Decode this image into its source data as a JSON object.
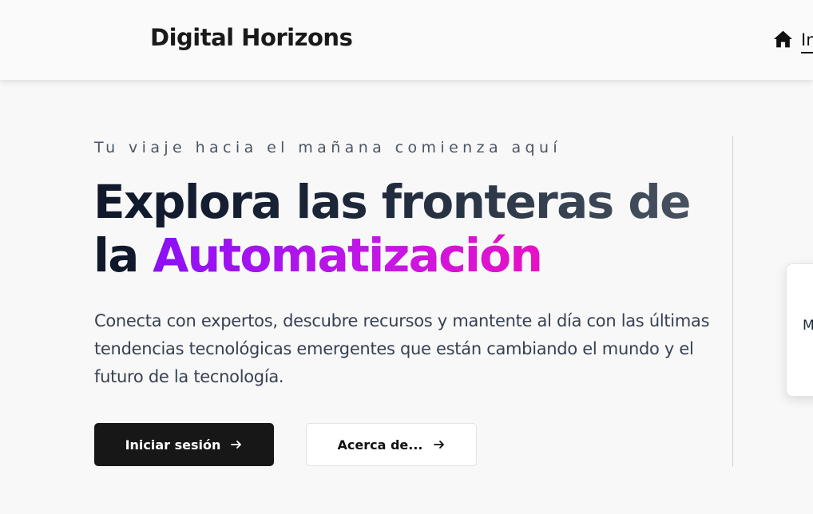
{
  "header": {
    "brand": "Digital Horizons",
    "nav": {
      "home_label": "In"
    }
  },
  "hero": {
    "eyebrow": "Tu viaje hacia el mañana comienza aquí",
    "headline_part1": "Explora las fronteras de la ",
    "headline_highlight": "Automatización",
    "description": "Conecta con expertos, descubre recursos y mantente al día con las últimas tendencias tecnológicas emergentes que están cambiando el mundo y el futuro de la tecnología.",
    "primary_button": "Iniciar sesión",
    "secondary_button": "Acerca de..."
  },
  "side_card": {
    "text": "M"
  },
  "icons": {
    "home": "home-icon",
    "arrow": "arrow-right-icon"
  },
  "colors": {
    "primary_button_bg": "#171717",
    "accent_gradient_start": "#8b10f7",
    "accent_gradient_end": "#ea0fc6"
  }
}
